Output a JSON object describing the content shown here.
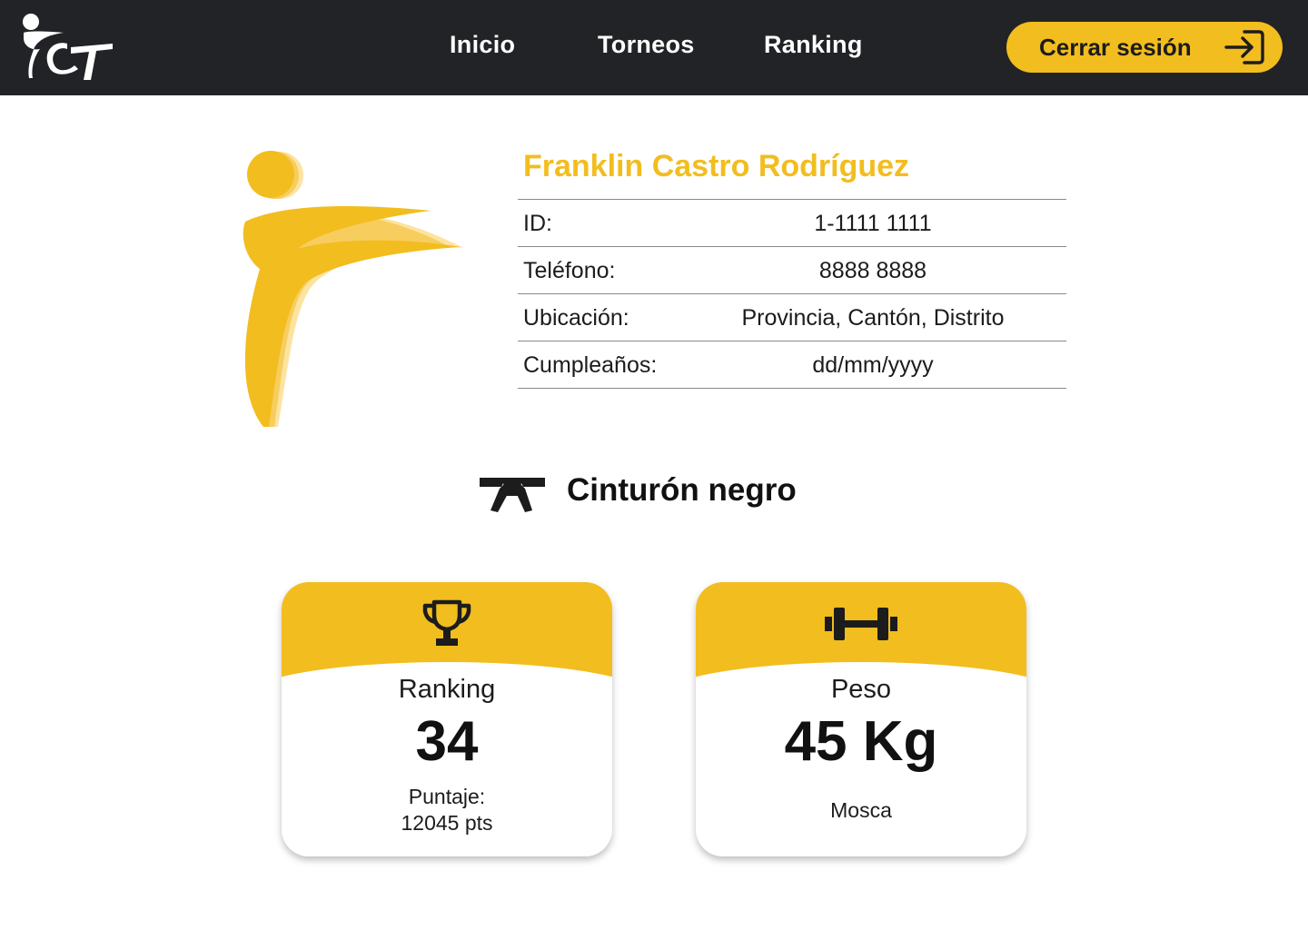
{
  "header": {
    "logo_text": "CT",
    "nav": {
      "inicio": "Inicio",
      "torneos": "Torneos",
      "ranking": "Ranking"
    },
    "logout_label": "Cerrar sesión"
  },
  "profile": {
    "name": "Franklin Castro Rodríguez",
    "fields": [
      {
        "label": "ID:",
        "value": "1-1111 1111"
      },
      {
        "label": "Teléfono:",
        "value": "8888 8888"
      },
      {
        "label": "Ubicación:",
        "value": "Provincia, Cantón, Distrito"
      },
      {
        "label": "Cumpleaños:",
        "value": "dd/mm/yyyy"
      }
    ]
  },
  "belt": {
    "label": "Cinturón negro",
    "icon": "belt-icon"
  },
  "cards": {
    "ranking": {
      "icon": "trophy-icon",
      "title": "Ranking",
      "value": "34",
      "sub_label": "Puntaje:",
      "sub_value": "12045 pts"
    },
    "peso": {
      "icon": "dumbbell-icon",
      "title": "Peso",
      "value": "45 Kg",
      "sub_value": "Mosca"
    }
  },
  "colors": {
    "accent": "#f2bd1e",
    "header_bg": "#222326",
    "text": "#111111"
  }
}
